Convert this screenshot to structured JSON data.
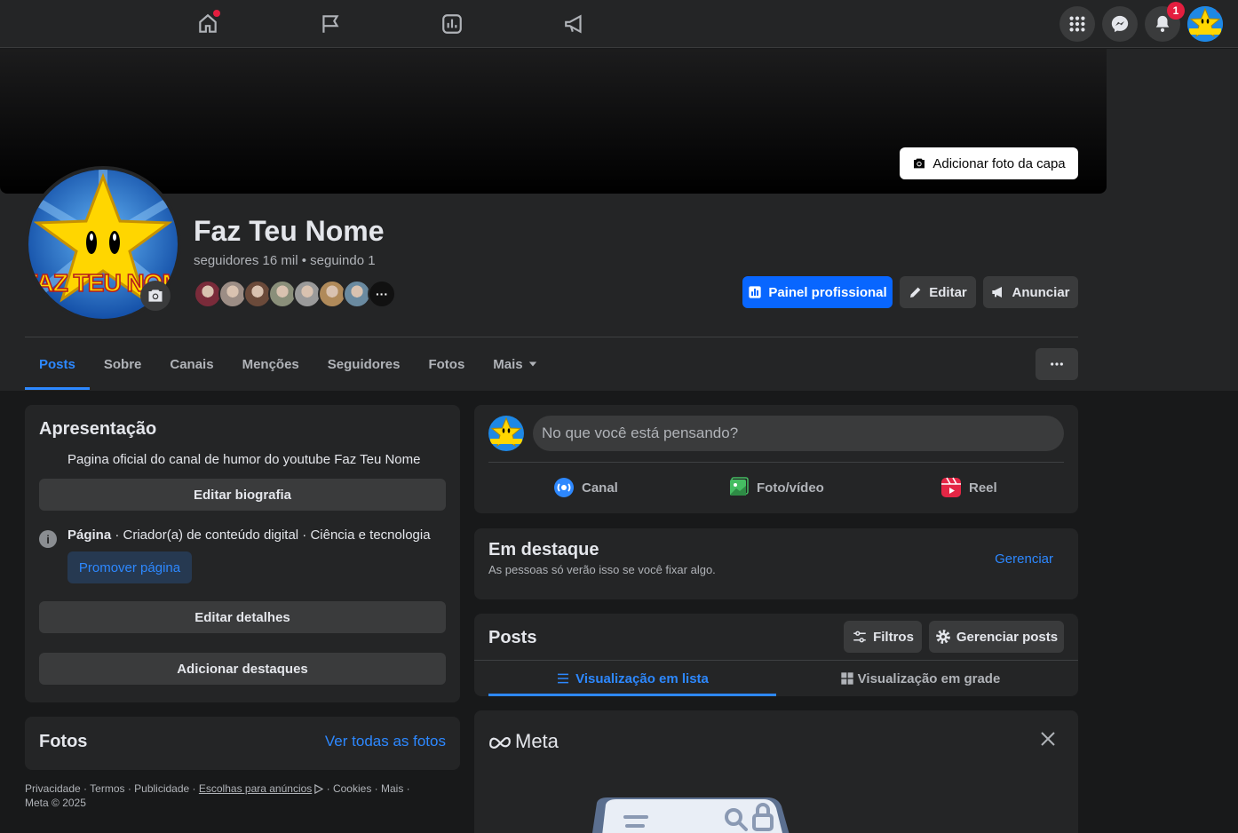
{
  "topbar": {
    "notification_count": "1"
  },
  "cover": {
    "add_cover_label": "Adicionar foto da capa"
  },
  "profile": {
    "name": "Faz Teu Nome",
    "follow_stats": "seguidores 16 mil • seguindo 1",
    "picture_text": "FAZ TEU NOME",
    "follower_colors": [
      "#7a2b3a",
      "#9c8d85",
      "#6b4a3a",
      "#8a8f7a",
      "#9a9a9a",
      "#b08a5a",
      "#6a8aa0"
    ],
    "more_followers": "···"
  },
  "actions": {
    "pro_panel": "Painel profissional",
    "edit": "Editar",
    "advertise": "Anunciar"
  },
  "tabs": [
    {
      "label": "Posts",
      "active": true
    },
    {
      "label": "Sobre"
    },
    {
      "label": "Canais"
    },
    {
      "label": "Menções"
    },
    {
      "label": "Seguidores"
    },
    {
      "label": "Fotos"
    },
    {
      "label": "Mais"
    }
  ],
  "intro": {
    "title": "Apresentação",
    "bio": "Pagina oficial do canal de humor do youtube Faz Teu Nome",
    "edit_bio": "Editar biografia",
    "page_type_bold": "Página",
    "page_type_rest": " · Criador(a) de conteúdo digital · Ciência e tecnologia",
    "promote": "Promover página",
    "edit_details": "Editar detalhes",
    "add_featured": "Adicionar destaques"
  },
  "photos": {
    "title": "Fotos",
    "see_all": "Ver todas as fotos"
  },
  "footer": {
    "line1": "Privacidade · Termos · Publicidade · ",
    "ad_choices": "Escolhas para anúncios",
    "line1_end": " · Cookies · Mais ·",
    "line2": "Meta © 2025"
  },
  "composer": {
    "placeholder": "No que você está pensando?",
    "channel": "Canal",
    "photo_video": "Foto/vídeo",
    "reel": "Reel"
  },
  "featured": {
    "title": "Em destaque",
    "subtitle": "As pessoas só verão isso se você fixar algo.",
    "manage": "Gerenciar"
  },
  "posts": {
    "title": "Posts",
    "filters": "Filtros",
    "manage_posts": "Gerenciar posts",
    "list_view": "Visualização em lista",
    "grid_view": "Visualização em grade"
  },
  "meta_card": {
    "brand": "Meta"
  }
}
